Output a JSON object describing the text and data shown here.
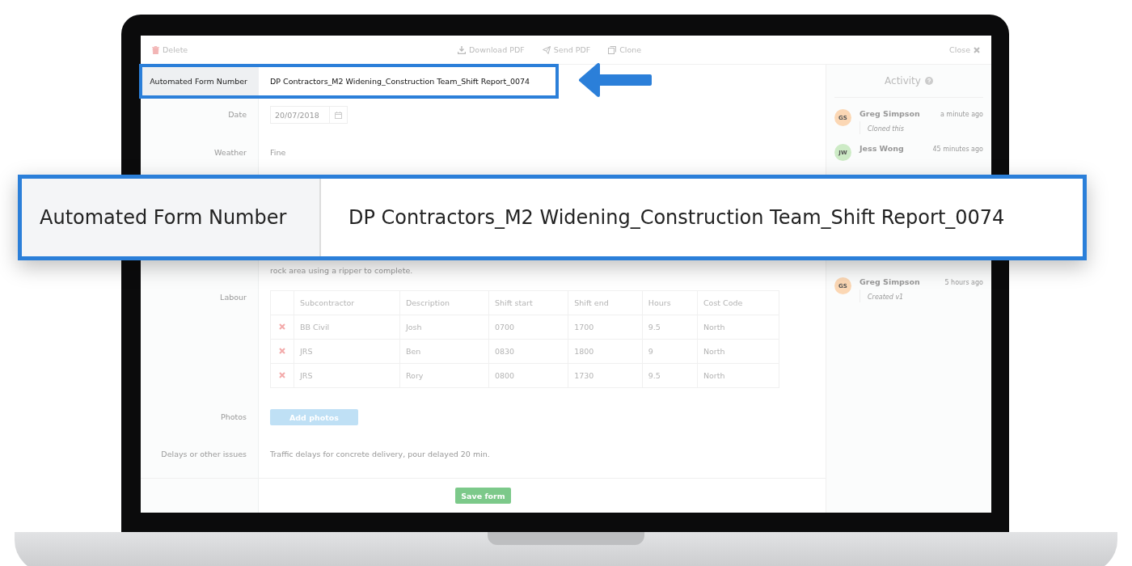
{
  "toolbar": {
    "delete": "Delete",
    "actions": [
      {
        "label": "Download PDF",
        "kind": "download"
      },
      {
        "label": "Send PDF",
        "kind": "send"
      },
      {
        "label": "Clone",
        "kind": "clone"
      }
    ],
    "close": "Close"
  },
  "form_number": {
    "label": "Automated Form Number",
    "value": "DP Contractors_M2 Widening_Construction Team_Shift Report_0074"
  },
  "date": {
    "label": "Date",
    "value": "20/07/2018"
  },
  "weather": {
    "label": "Weather",
    "value": "Fine"
  },
  "summary_tail": "rock area using a ripper to complete.",
  "labour": {
    "label": "Labour",
    "columns": [
      "Subcontractor",
      "Description",
      "Shift start",
      "Shift end",
      "Hours",
      "Cost Code"
    ],
    "rows": [
      [
        "BB Civil",
        "Josh",
        "0700",
        "1700",
        "9.5",
        "North"
      ],
      [
        "JRS",
        "Ben",
        "0830",
        "1800",
        "9",
        "North"
      ],
      [
        "JRS",
        "Rory",
        "0800",
        "1730",
        "9.5",
        "North"
      ]
    ]
  },
  "photos": {
    "label": "Photos",
    "button": "Add photos"
  },
  "delays": {
    "label": "Delays or other issues",
    "value": "Traffic delays for concrete delivery, pour delayed 20 min."
  },
  "save_button": "Save form",
  "activity": {
    "title": "Activity",
    "items": [
      {
        "initials": "GS",
        "color": "#fbd7b4",
        "name": "Greg Simpson",
        "time": "a minute ago",
        "note": "Cloned this"
      },
      {
        "initials": "JW",
        "color": "#cdebc6",
        "name": "Jess Wong",
        "time": "45 minutes ago"
      },
      {
        "initials": "GS",
        "color": "#fbd7b4",
        "name": "Greg Simpson",
        "time": "5 hours ago",
        "note": "Created v1"
      }
    ]
  },
  "callout": {
    "label": "Automated Form Number",
    "value": "DP Contractors_M2 Widening_Construction Team_Shift Report_0074"
  }
}
